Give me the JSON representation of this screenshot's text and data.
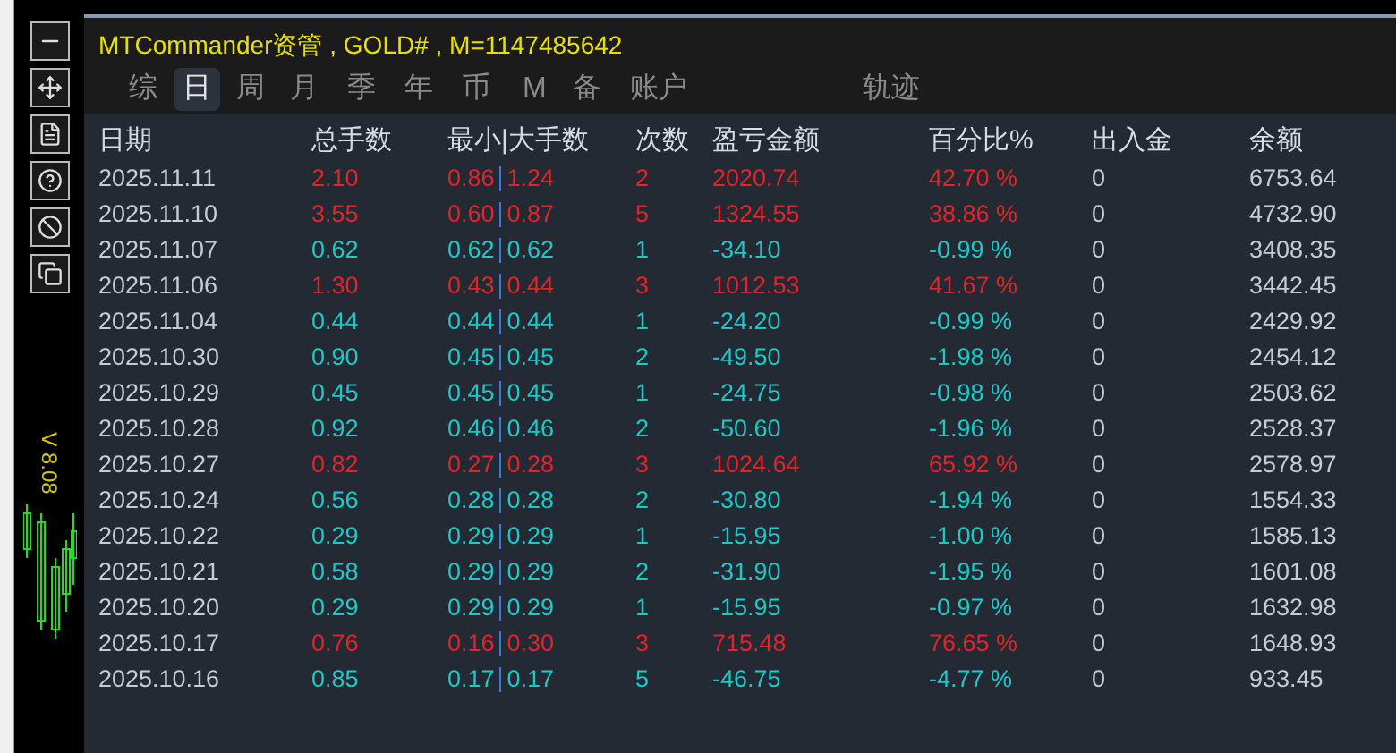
{
  "title": "MTCommander资管 , GOLD# , M=1147485642",
  "chart_label": "V 8.08",
  "tabs": [
    {
      "label": "综",
      "selected": false
    },
    {
      "label": "日",
      "selected": true
    },
    {
      "label": "周",
      "selected": false
    },
    {
      "label": "月",
      "selected": false
    },
    {
      "label": "季",
      "selected": false
    },
    {
      "label": "年",
      "selected": false
    },
    {
      "label": "币",
      "selected": false
    },
    {
      "label": "M",
      "selected": false
    },
    {
      "label": "备",
      "selected": false
    },
    {
      "label": "账户",
      "selected": false
    },
    {
      "label": "轨迹",
      "selected": false
    }
  ],
  "columns": [
    "日期",
    "总手数",
    "最小|大手数",
    "次数",
    "盈亏金额",
    "百分比%",
    "出入金",
    "余额"
  ],
  "rows": [
    {
      "kind": "gain",
      "cells": [
        "2025.11.11",
        "2.10",
        "0.86",
        "1.24",
        "2",
        "2020.74",
        "42.70 %",
        "0",
        "6753.64"
      ]
    },
    {
      "kind": "gain",
      "cells": [
        "2025.11.10",
        "3.55",
        "0.60",
        "0.87",
        "5",
        "1324.55",
        "38.86 %",
        "0",
        "4732.90"
      ]
    },
    {
      "kind": "loss",
      "cells": [
        "2025.11.07",
        "0.62",
        "0.62",
        "0.62",
        "1",
        "-34.10",
        "-0.99 %",
        "0",
        "3408.35"
      ]
    },
    {
      "kind": "gain",
      "cells": [
        "2025.11.06",
        "1.30",
        "0.43",
        "0.44",
        "3",
        "1012.53",
        "41.67 %",
        "0",
        "3442.45"
      ]
    },
    {
      "kind": "loss",
      "cells": [
        "2025.11.04",
        "0.44",
        "0.44",
        "0.44",
        "1",
        "-24.20",
        "-0.99 %",
        "0",
        "2429.92"
      ]
    },
    {
      "kind": "loss",
      "cells": [
        "2025.10.30",
        "0.90",
        "0.45",
        "0.45",
        "2",
        "-49.50",
        "-1.98 %",
        "0",
        "2454.12"
      ]
    },
    {
      "kind": "loss",
      "cells": [
        "2025.10.29",
        "0.45",
        "0.45",
        "0.45",
        "1",
        "-24.75",
        "-0.98 %",
        "0",
        "2503.62"
      ]
    },
    {
      "kind": "loss",
      "cells": [
        "2025.10.28",
        "0.92",
        "0.46",
        "0.46",
        "2",
        "-50.60",
        "-1.96 %",
        "0",
        "2528.37"
      ]
    },
    {
      "kind": "gain",
      "cells": [
        "2025.10.27",
        "0.82",
        "0.27",
        "0.28",
        "3",
        "1024.64",
        "65.92 %",
        "0",
        "2578.97"
      ]
    },
    {
      "kind": "loss",
      "cells": [
        "2025.10.24",
        "0.56",
        "0.28",
        "0.28",
        "2",
        "-30.80",
        "-1.94 %",
        "0",
        "1554.33"
      ]
    },
    {
      "kind": "loss",
      "cells": [
        "2025.10.22",
        "0.29",
        "0.29",
        "0.29",
        "1",
        "-15.95",
        "-1.00 %",
        "0",
        "1585.13"
      ]
    },
    {
      "kind": "loss",
      "cells": [
        "2025.10.21",
        "0.58",
        "0.29",
        "0.29",
        "2",
        "-31.90",
        "-1.95 %",
        "0",
        "1601.08"
      ]
    },
    {
      "kind": "loss",
      "cells": [
        "2025.10.20",
        "0.29",
        "0.29",
        "0.29",
        "1",
        "-15.95",
        "-0.97 %",
        "0",
        "1632.98"
      ]
    },
    {
      "kind": "gain",
      "cells": [
        "2025.10.17",
        "0.76",
        "0.16",
        "0.30",
        "3",
        "715.48",
        "76.65 %",
        "0",
        "1648.93"
      ]
    },
    {
      "kind": "loss",
      "cells": [
        "2025.10.16",
        "0.85",
        "0.17",
        "0.17",
        "5",
        "-46.75",
        "-4.77 %",
        "0",
        "933.45"
      ]
    }
  ]
}
